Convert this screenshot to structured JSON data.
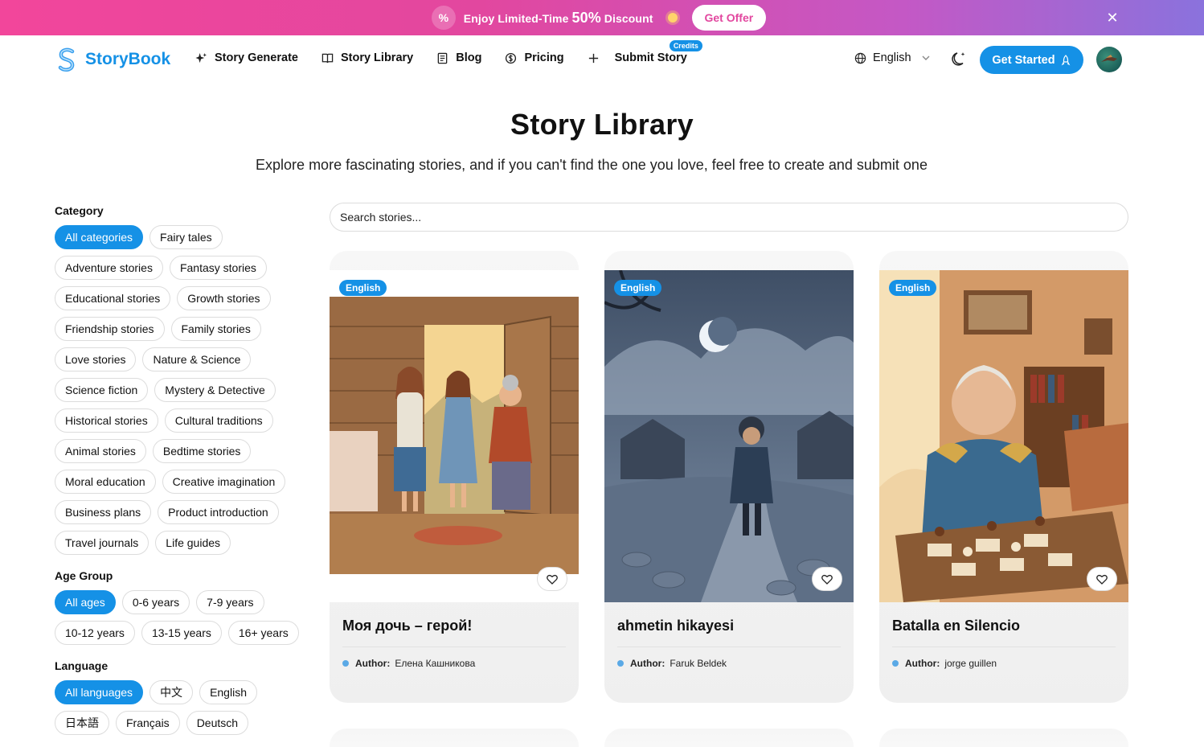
{
  "promo": {
    "text": "Enjoy Limited-Time",
    "highlight": "50%",
    "suffix": "Discount",
    "cta": "Get Offer",
    "badge": "%",
    "close": "✕"
  },
  "brand": {
    "name": "StoryBook",
    "accent": "#1591e6"
  },
  "nav": {
    "items": [
      {
        "label": "Story Generate",
        "icon": "sparkle-icon"
      },
      {
        "label": "Story Library",
        "icon": "book-icon"
      },
      {
        "label": "Blog",
        "icon": "document-icon"
      },
      {
        "label": "Pricing",
        "icon": "coin-icon"
      },
      {
        "label": "Submit Story",
        "icon": "plus-icon",
        "badge": "Credits"
      }
    ],
    "language": "English",
    "get_started": "Get Started"
  },
  "hero": {
    "title": "Story Library",
    "subtitle": "Explore more fascinating stories, and if you can't find the one you love, feel free to create and submit one"
  },
  "filters": {
    "category": {
      "title": "Category",
      "options": [
        "All categories",
        "Fairy tales",
        "Adventure stories",
        "Fantasy stories",
        "Educational stories",
        "Growth stories",
        "Friendship stories",
        "Family stories",
        "Love stories",
        "Nature & Science",
        "Science fiction",
        "Mystery & Detective",
        "Historical stories",
        "Cultural traditions",
        "Animal stories",
        "Bedtime stories",
        "Moral education",
        "Creative imagination",
        "Business plans",
        "Product introduction",
        "Travel journals",
        "Life guides"
      ],
      "selected": "All categories"
    },
    "age": {
      "title": "Age Group",
      "options": [
        "All ages",
        "0-6 years",
        "7-9 years",
        "10-12 years",
        "13-15 years",
        "16+ years"
      ],
      "selected": "All ages"
    },
    "language": {
      "title": "Language",
      "options": [
        "All languages",
        "中文",
        "English",
        "日本語",
        "Français",
        "Deutsch"
      ],
      "selected": "All languages"
    }
  },
  "search": {
    "placeholder": "Search stories..."
  },
  "stories": [
    {
      "title": "Моя дочь – герой!",
      "language": "English",
      "author_label": "Author:",
      "author": "Елена Кашникова"
    },
    {
      "title": "ahmetin hikayesi",
      "language": "English",
      "author_label": "Author:",
      "author": "Faruk Beldek"
    },
    {
      "title": "Batalla en Silencio",
      "language": "English",
      "author_label": "Author:",
      "author": "jorge guillen"
    }
  ]
}
